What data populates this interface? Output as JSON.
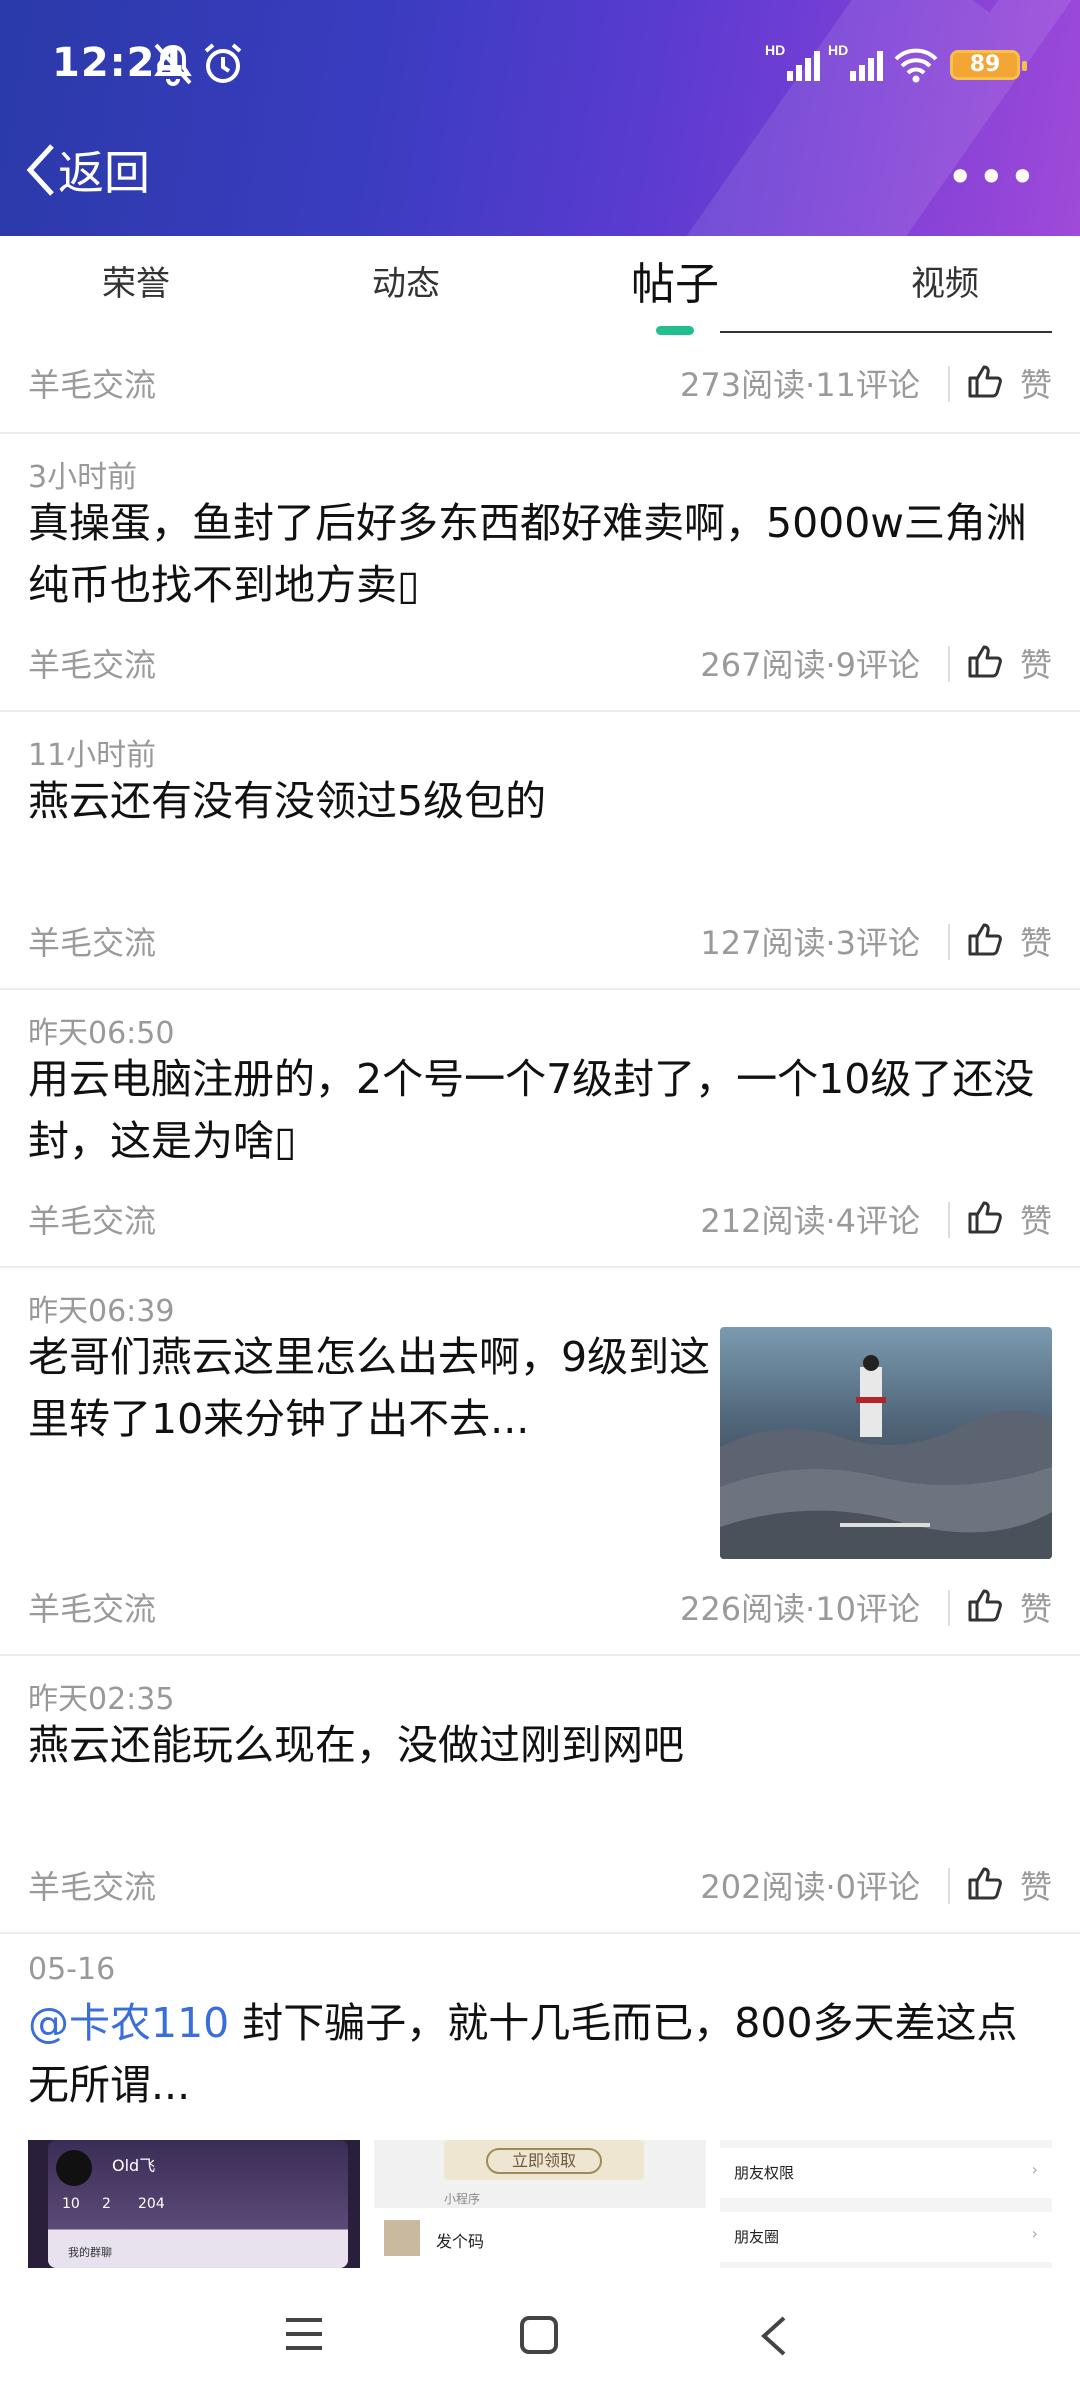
{
  "status_bar": {
    "time": "12:24",
    "battery": "89",
    "icons": [
      "mute-bell-icon",
      "alarm-icon",
      "hd-signal-icon",
      "hd-signal-icon",
      "wifi-icon",
      "battery-icon"
    ]
  },
  "header": {
    "back_label": "返回",
    "more_label": "•••"
  },
  "tabs": [
    {
      "label": "荣誉",
      "active": false
    },
    {
      "label": "动态",
      "active": false
    },
    {
      "label": "帖子",
      "active": true
    },
    {
      "label": "视频",
      "active": false
    }
  ],
  "like_label": "赞",
  "posts": [
    {
      "time": "",
      "title": "",
      "board": "羊毛交流",
      "stats": "273阅读·11评论"
    },
    {
      "time": "3小时前",
      "title": "真操蛋，鱼封了后好多东西都好难卖啊，5000w三角洲纯币也找不到地方卖▯",
      "board": "羊毛交流",
      "stats": "267阅读·9评论"
    },
    {
      "time": "11小时前",
      "title": "燕云还有没有没领过5级包的",
      "board": "羊毛交流",
      "stats": "127阅读·3评论"
    },
    {
      "time": "昨天06:50",
      "title": "用云电脑注册的，2个号一个7级封了，一个10级了还没封，这是为啥▯",
      "board": "羊毛交流",
      "stats": "212阅读·4评论"
    },
    {
      "time": "昨天06:39",
      "title": "老哥们燕云这里怎么出去啊，9级到这里转了10来分钟了出不去...",
      "board": "羊毛交流",
      "stats": "226阅读·10评论"
    },
    {
      "time": "昨天02:35",
      "title": "燕云还能玩么现在，没做过刚到网吧",
      "board": "羊毛交流",
      "stats": "202阅读·0评论"
    },
    {
      "time": "05-16",
      "mention": "@卡农110",
      "title": " 封下骗子，就十几毛而已，800多天差这点无所谓..."
    }
  ],
  "thumbnails": {
    "t1_name": "Old飞",
    "t1_stats": [
      "10",
      "2",
      "204"
    ],
    "t1_menu": "我的群聊",
    "t2_button": "立即领取",
    "t2_caption": "小程序",
    "t2_label": "发个码",
    "t3_items": [
      "朋友权限",
      "朋友圈"
    ]
  },
  "nav": {
    "icons": [
      "menu-icon",
      "home-icon",
      "back-icon"
    ]
  },
  "colors": {
    "accent": "#1fbf8f",
    "mention": "#3a6ed8",
    "battery": "#f3a536"
  }
}
